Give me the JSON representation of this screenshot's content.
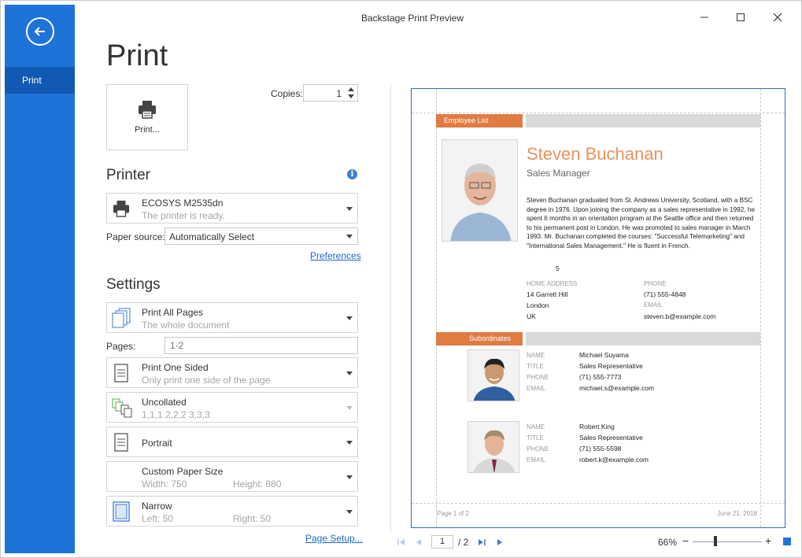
{
  "window": {
    "title": "Backstage Print Preview"
  },
  "sidebar": {
    "items": [
      {
        "label": "Print"
      }
    ]
  },
  "print": {
    "heading": "Print",
    "button_label": "Print...",
    "copies_label": "Copies:",
    "copies_value": "1"
  },
  "printer": {
    "heading": "Printer",
    "name": "ECOSYS M2535dn",
    "status": "The printer is ready.",
    "paper_source_label": "Paper source:",
    "paper_source_value": "Automatically Select",
    "preferences_link": "Preferences"
  },
  "settings": {
    "heading": "Settings",
    "pages_label": "Pages:",
    "pages_placeholder": "1-2",
    "page_setup_link": "Page Setup...",
    "items": [
      {
        "title": "Print All Pages",
        "subtitle": "The whole document"
      },
      {
        "title": "Print One Sided",
        "subtitle": "Only print one side of the page"
      },
      {
        "title": "Uncollated",
        "subtitle": "1,1,1   2,2,2   3,3,3"
      },
      {
        "title": "Portrait"
      },
      {
        "title": "Custom Paper Size",
        "subtitle": "Width: 750",
        "subtitle2": "Height: 880"
      },
      {
        "title": "Narrow",
        "subtitle": "Left: 50",
        "subtitle2": "Right: 50"
      }
    ]
  },
  "preview": {
    "section1": "Employee List",
    "employee": {
      "name": "Steven Buchanan",
      "title": "Sales Manager",
      "bio": "Steven Buchanan graduated from St. Andrews University, Scotland, with a BSC degree in 1976. Upon joining the company as a sales representative in 1992, he spent 6 months in an orientation program at the Seattle office and then returned to his permanent post in London. He was promoted to sales manager in March 1993. Mr. Buchanan completed the courses: \"Successful Telemarketing\" and \"International Sales Management.\" He is fluent in French.",
      "bio_number": "5",
      "home_address_label": "HOME ADDRESS",
      "address_line1": "14 Garrett Hill",
      "address_line2": "London",
      "address_line3": "UK",
      "phone_label": "PHONE",
      "phone": "(71) 555-4848",
      "email_label": "EMAIL",
      "email": "steven.b@example.com"
    },
    "section2": "Subordinates",
    "field_labels": {
      "name": "NAME",
      "title": "TITLE",
      "phone": "PHONE",
      "email": "EMAIL"
    },
    "subordinates": [
      {
        "name": "Michael Suyama",
        "title": "Sales Representative",
        "phone": "(71) 555-7773",
        "email": "michael.s@example.com"
      },
      {
        "name": "Robert King",
        "title": "Sales Representative",
        "phone": "(71) 555-5598",
        "email": "robert.k@example.com"
      }
    ],
    "footer_left": "Page 1 of 2",
    "footer_right": "June 21, 2018"
  },
  "statusbar": {
    "current_page": "1",
    "total_pages": "/ 2",
    "zoom": "66%",
    "zoom_fraction": 0.33
  },
  "colors": {
    "sidebar": "#1e73d8",
    "sidebar_selected": "#1259b3",
    "accent_orange": "#e07b42",
    "link": "#1e66c4"
  }
}
